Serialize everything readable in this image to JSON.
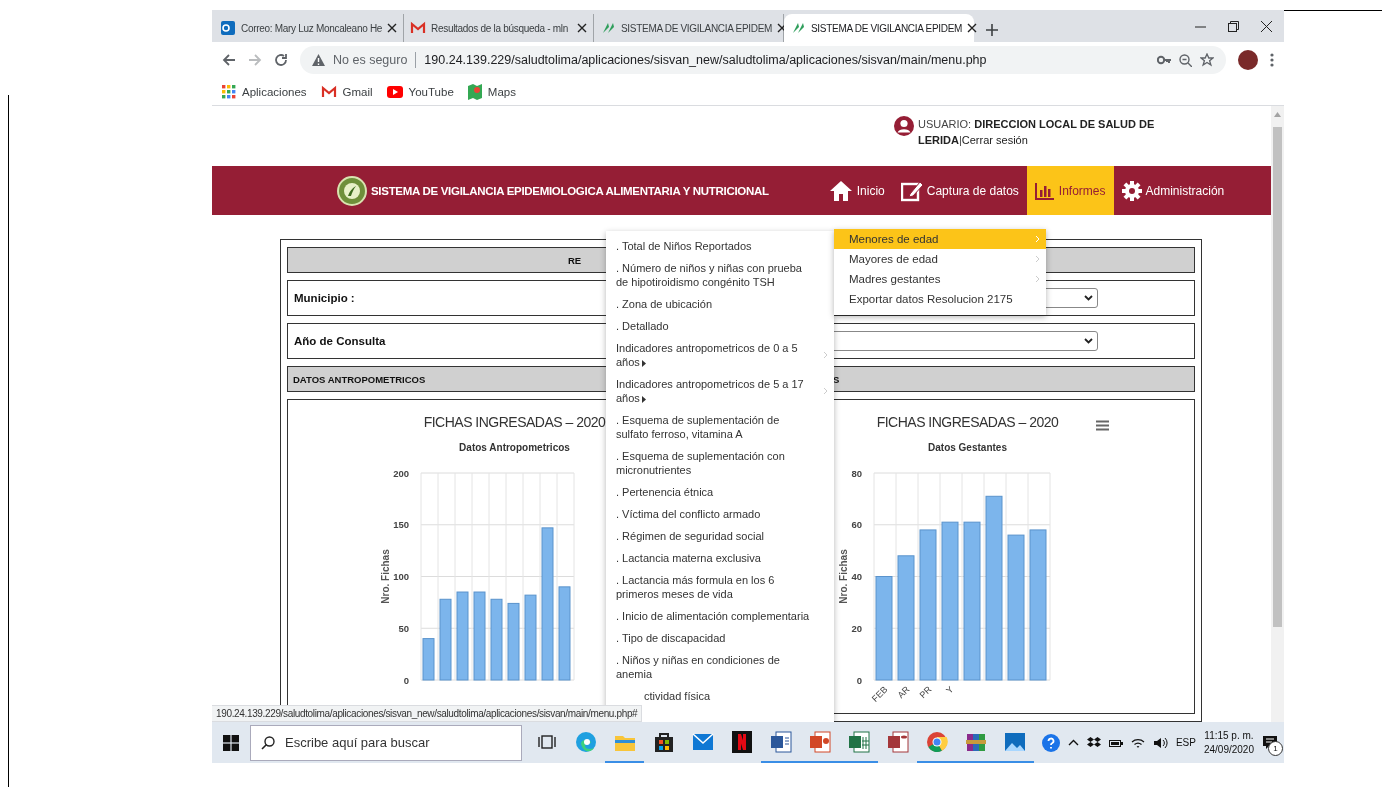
{
  "browser": {
    "tabs": [
      {
        "title": "Correo: Mary Luz Moncaleano He",
        "kind": "outlook",
        "selected": false
      },
      {
        "title": "Resultados de la búsqueda - mln",
        "kind": "gmail",
        "selected": false
      },
      {
        "title": "SISTEMA DE VIGILANCIA EPIDEM",
        "kind": "sisvan",
        "selected": false
      },
      {
        "title": "SISTEMA DE VIGILANCIA EPIDEM",
        "kind": "sisvan",
        "selected": true
      }
    ],
    "security_label": "No es seguro",
    "url": "190.24.139.229/saludtolima/aplicaciones/sisvan_new/saludtolima/aplicaciones/sisvan/main/menu.php",
    "bookmarks": [
      {
        "label": "Aplicaciones",
        "kind": "apps"
      },
      {
        "label": "Gmail",
        "kind": "gmail"
      },
      {
        "label": "YouTube",
        "kind": "youtube"
      },
      {
        "label": "Maps",
        "kind": "maps"
      }
    ]
  },
  "page": {
    "user": {
      "text": "USUARIO: **DIRECCION LOCAL DE SALUD DE LERIDA**|",
      "logout": "Cerrar sesión"
    },
    "app_title": "SISTEMA DE VIGILANCIA EPIDEMIOLOGICA ALIMENTARIA Y NUTRICIONAL",
    "nav": [
      {
        "label": "Inicio",
        "kind": "home",
        "selected": false
      },
      {
        "label": "Captura de datos",
        "kind": "edit",
        "selected": false
      },
      {
        "label": "Informes",
        "kind": "chart",
        "selected": true
      },
      {
        "label": "Administración",
        "kind": "gear",
        "selected": false
      }
    ],
    "report_header": "RE",
    "filters": [
      {
        "label": "Municipio :"
      },
      {
        "label": "Año de Consulta"
      }
    ],
    "section_headers": [
      "DATOS ANTROPOMETRICOS",
      "S"
    ],
    "charts": [
      {
        "subtitle": "Datos Antropometricos",
        "has_menu": false,
        "chart_data": {
          "type": "bar",
          "title": "FICHAS INGRESADAS – 2020",
          "ylabel": "Nro. Fichas",
          "grid": true,
          "ylim": [
            0,
            200
          ],
          "yticks": [
            0,
            50,
            100,
            150,
            200
          ],
          "categories": [
            null,
            null,
            null,
            null,
            null,
            null,
            null,
            null,
            null
          ],
          "values": [
            40,
            78,
            85,
            85,
            78,
            74,
            82,
            147,
            90
          ]
        }
      },
      {
        "subtitle": "Datos Gestantes",
        "has_menu": true,
        "chart_data": {
          "type": "bar",
          "title": "FICHAS INGRESADAS – 2020",
          "ylabel": "Nro. Fichas",
          "grid": true,
          "ylim": [
            0,
            80
          ],
          "yticks": [
            0,
            20,
            40,
            60,
            80
          ],
          "categories": [
            "FEB",
            "AR",
            "PR",
            "Y",
            null,
            null,
            null,
            null
          ],
          "values": [
            40,
            48,
            58,
            61,
            61,
            71,
            56,
            58
          ]
        }
      }
    ],
    "informes_menu": [
      {
        "label": "Menores de edad",
        "selected": true,
        "has_submenu": true
      },
      {
        "label": "Mayores de edad",
        "selected": false,
        "has_submenu": true
      },
      {
        "label": "Madres gestantes",
        "selected": false,
        "has_submenu": true
      },
      {
        "label": "Exportar datos Resolucion 2175",
        "selected": false,
        "has_submenu": false
      }
    ],
    "submenu": [
      {
        "label": ". Total de Niños Reportados",
        "has_submenu": false
      },
      {
        "label": ". Número de niños y niñas con prueba de hipotiroidismo congénito TSH",
        "has_submenu": false
      },
      {
        "label": ". Zona de ubicación",
        "has_submenu": false
      },
      {
        "label": ". Detallado",
        "has_submenu": false
      },
      {
        "label": "Indicadores antropometricos de 0 a 5 años",
        "has_submenu": true
      },
      {
        "label": "Indicadores antropometricos de 5 a 17 años",
        "has_submenu": true
      },
      {
        "label": ". Esquema de suplementación de sulfato ferroso, vitamina A",
        "has_submenu": false
      },
      {
        "label": ". Esquema de suplementación con micronutrientes",
        "has_submenu": false
      },
      {
        "label": ". Pertenencia étnica",
        "has_submenu": false
      },
      {
        "label": ". Víctima del conflicto armado",
        "has_submenu": false
      },
      {
        "label": ". Régimen de seguridad social",
        "has_submenu": false
      },
      {
        "label": ". Lactancia materna exclusiva",
        "has_submenu": false
      },
      {
        "label": ". Lactancia más formula en los 6 primeros meses de vida",
        "has_submenu": false
      },
      {
        "label": ". Inicio de alimentación complementaria",
        "has_submenu": false
      },
      {
        "label": ". Tipo de discapacidad",
        "has_submenu": false
      },
      {
        "label": ". Niños y niñas en condiciones de anemia",
        "has_submenu": false
      },
      {
        "label": "ctividad física",
        "has_submenu": false
      }
    ]
  },
  "status_url": "190.24.139.229/saludtolima/aplicaciones/sisvan_new/saludtolima/aplicaciones/sisvan/main/menu.php#",
  "taskbar": {
    "search_placeholder": "Escribe aquí para buscar",
    "apps": [
      {
        "kind": "taskview",
        "running": false
      },
      {
        "kind": "edge",
        "running": false
      },
      {
        "kind": "explorer",
        "running": true
      },
      {
        "kind": "store",
        "running": false
      },
      {
        "kind": "mail",
        "running": false
      },
      {
        "kind": "netflix",
        "running": false
      },
      {
        "kind": "word",
        "running": true
      },
      {
        "kind": "powerpoint",
        "running": true
      },
      {
        "kind": "excel",
        "running": true
      },
      {
        "kind": "access",
        "running": false
      },
      {
        "kind": "chrome",
        "running": true
      },
      {
        "kind": "winrar",
        "running": true
      },
      {
        "kind": "photos",
        "running": true
      }
    ],
    "language": "ESP",
    "time": "11:15 p. m.",
    "date": "24/09/2020",
    "notification_count": "1"
  }
}
